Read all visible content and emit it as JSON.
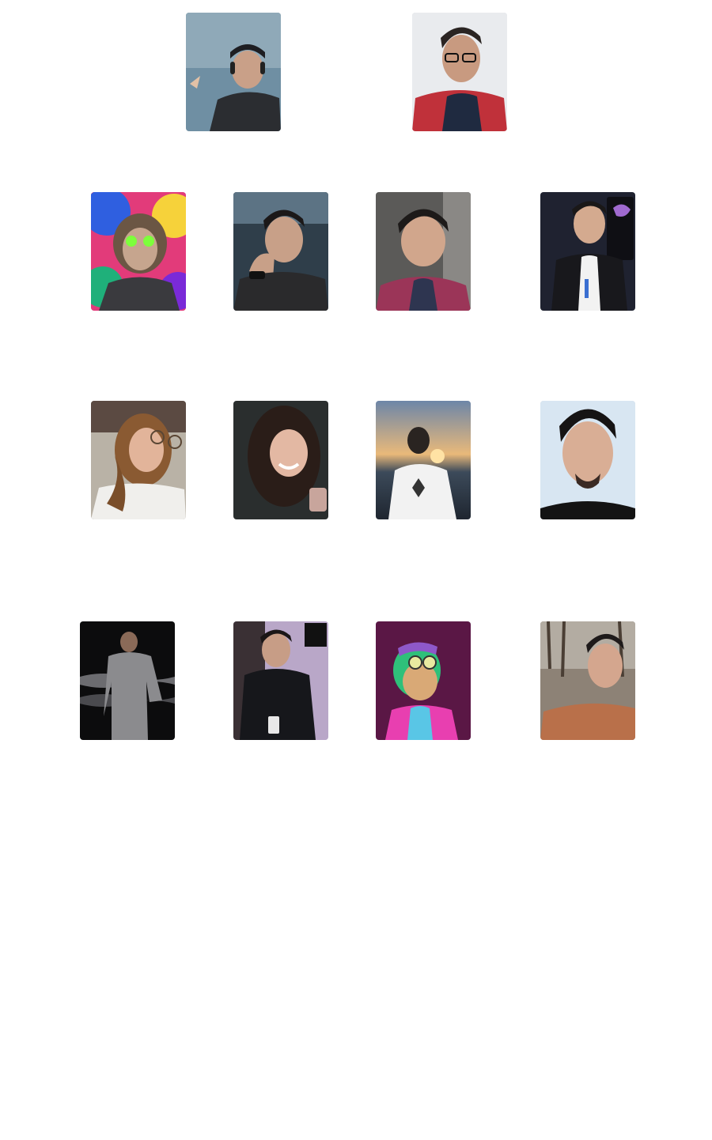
{
  "team": {
    "members": [
      {
        "name": ""
      },
      {
        "name": ""
      },
      {
        "name": ""
      },
      {
        "name": ""
      },
      {
        "name": ""
      },
      {
        "name": ""
      },
      {
        "name": ""
      },
      {
        "name": ""
      },
      {
        "name": ""
      },
      {
        "name": ""
      },
      {
        "name": ""
      },
      {
        "name": ""
      },
      {
        "name": ""
      },
      {
        "name": ""
      }
    ]
  }
}
